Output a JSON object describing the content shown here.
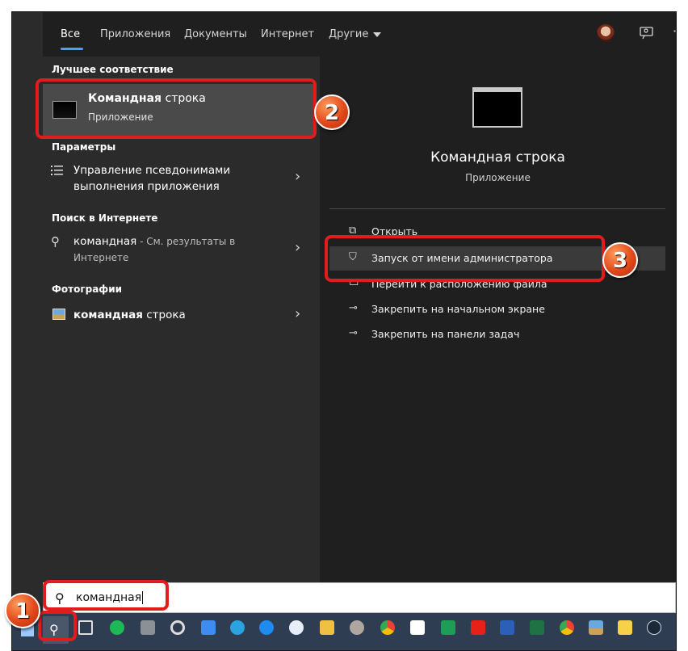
{
  "tabs": [
    "Все",
    "Приложения",
    "Документы",
    "Интернет",
    "Другие"
  ],
  "left": {
    "best_match_header": "Лучшее соответствие",
    "best_match": {
      "title_bold": "Командная",
      "title_rest": " строка",
      "subtitle": "Приложение"
    },
    "settings_header": "Параметры",
    "settings_item": {
      "line1": "Управление псевдонимами",
      "line2": "выполнения приложения"
    },
    "web_header": "Поиск в Интернете",
    "web_item": {
      "query": "командная",
      "suffix": " - См. результаты в",
      "line2": "Интернете"
    },
    "photos_header": "Фотографии",
    "photos_item": {
      "bold": "командная",
      "rest": " строка"
    }
  },
  "right": {
    "title": "Командная строка",
    "subtitle": "Приложение",
    "actions": [
      {
        "label": "Открыть",
        "icon": "open-icon"
      },
      {
        "label": "Запуск от имени администратора",
        "icon": "shield-icon"
      },
      {
        "label": "Перейти к расположению файла",
        "icon": "folder-icon"
      },
      {
        "label": "Закрепить на начальном экране",
        "icon": "pin-icon"
      },
      {
        "label": "Закрепить на панели задач",
        "icon": "pin-icon"
      }
    ]
  },
  "search": {
    "value": "командная"
  },
  "badges": [
    "1",
    "2",
    "3"
  ],
  "taskbar_icons": [
    "task-view-icon",
    "spotify-icon",
    "calculator-icon",
    "edge-icon",
    "todo-icon",
    "telegram-icon",
    "onedrive-icon",
    "skype-icon",
    "explorer-icon",
    "avatar-icon",
    "chrome-icon",
    "calendar-icon",
    "sheets-icon",
    "youtube-icon",
    "word-icon",
    "excel-icon",
    "chrome-icon",
    "photos-icon",
    "sticky-icon",
    "steam-icon"
  ],
  "colors": {
    "accent": "#4aa0ff",
    "annotation": "#e01c1c",
    "taskbar": "#2f3d52"
  }
}
